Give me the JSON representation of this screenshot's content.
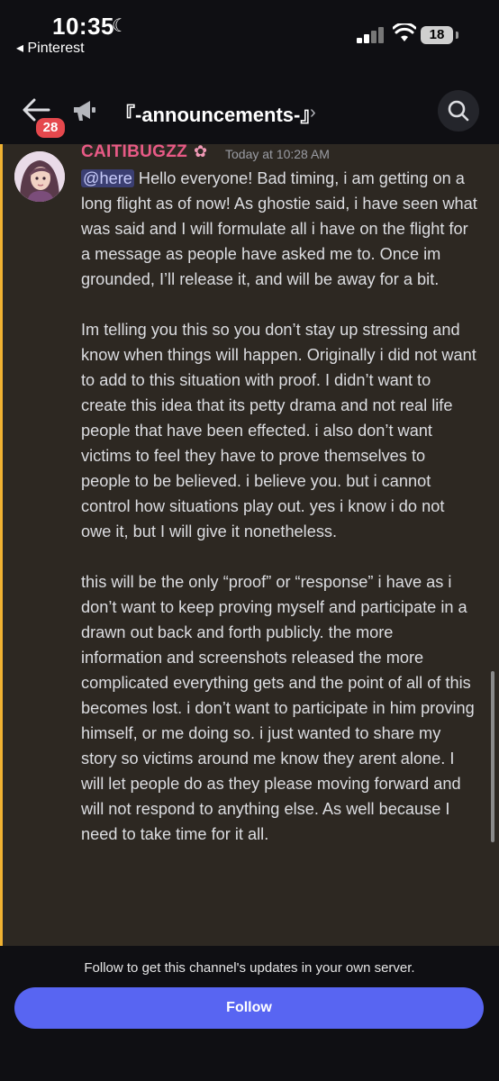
{
  "status_bar": {
    "time": "10:35",
    "back_app": "◂ Pinterest",
    "battery": "18"
  },
  "header": {
    "unread_count": "28",
    "channel_name": "『-announcements-』",
    "chevron": "›"
  },
  "message": {
    "author": "CAITIBUGZZ",
    "timestamp": "Today at 10:28 AM",
    "mention": "@here",
    "paragraph_1": " Hello everyone! Bad timing, i am getting on a long flight as of now! As ghostie said, i have seen what was said and I will formulate all i have on the flight for a message as people have asked me to. Once im grounded, I’ll release it, and will be away for a bit.",
    "paragraph_2": "Im telling you this so you don’t stay up stressing and know when things will happen. Originally i did not want to add to this situation with proof. I didn’t want to create this idea that its petty drama and not real life people that have been effected. i also don’t want victims to feel they have to prove themselves to people to be believed. i believe you. but i cannot control how situations play out. yes i know i do not owe it, but I will give it nonetheless.",
    "paragraph_3": "this will be the only “proof” or “response” i have as i don’t want to keep proving myself and participate in a drawn out back and forth publicly. the more information and screenshots released the more complicated everything gets and the point of all of this becomes lost. i don’t want to participate in him proving himself, or me doing so. i just wanted to share my story so victims around me know they arent alone. I will let people do as they please moving forward and will not respond to anything else. As well  because I need to take time for it all."
  },
  "footer": {
    "prompt": "Follow to get this channel's updates in your own server.",
    "follow_label": "Follow"
  },
  "colors": {
    "accent_bar": "#f0b232",
    "author": "#e85a86",
    "follow_button": "#5865f2",
    "badge": "#e5484d"
  },
  "icons": [
    "moon-icon",
    "signal-icon",
    "wifi-icon",
    "battery-icon",
    "back-arrow-icon",
    "megaphone-icon",
    "search-icon",
    "flower-icon"
  ]
}
